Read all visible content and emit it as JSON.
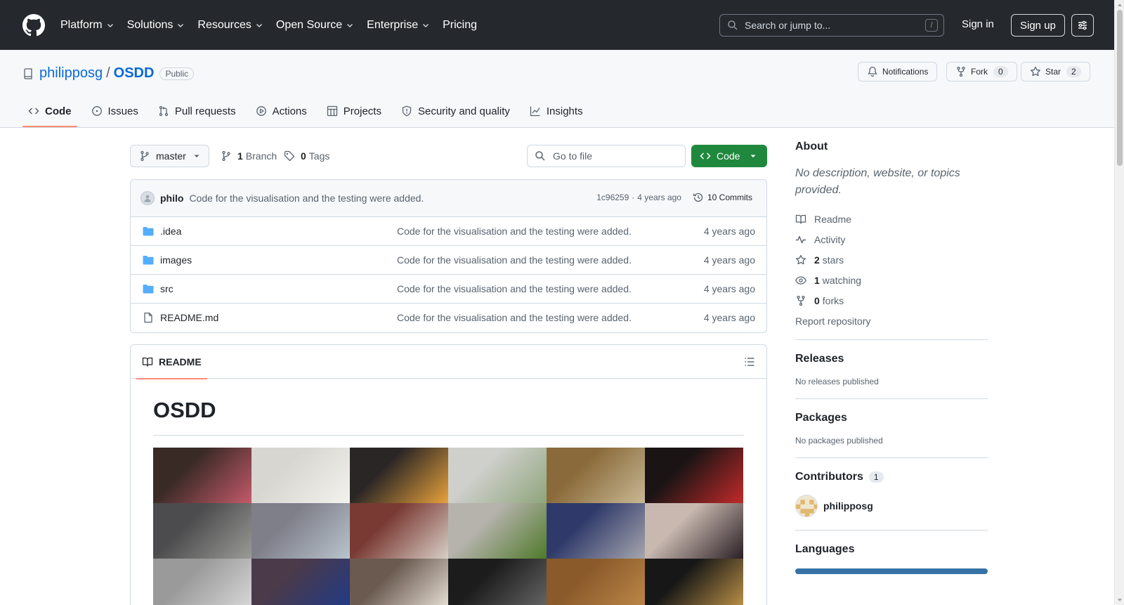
{
  "header": {
    "nav": [
      {
        "label": "Platform",
        "dropdown": true
      },
      {
        "label": "Solutions",
        "dropdown": true
      },
      {
        "label": "Resources",
        "dropdown": true
      },
      {
        "label": "Open Source",
        "dropdown": true
      },
      {
        "label": "Enterprise",
        "dropdown": true
      },
      {
        "label": "Pricing",
        "dropdown": false
      }
    ],
    "search_placeholder": "Search or jump to...",
    "search_shortcut": "/",
    "signin_label": "Sign in",
    "signup_label": "Sign up"
  },
  "repo": {
    "owner": "philipposg",
    "separator": "/",
    "name": "OSDD",
    "visibility": "Public",
    "notifications_label": "Notifications",
    "fork_label": "Fork",
    "fork_count": "0",
    "star_label": "Star",
    "star_count": "2"
  },
  "tabs": [
    {
      "label": "Code",
      "icon": "code-icon",
      "active": true
    },
    {
      "label": "Issues",
      "icon": "issue-icon",
      "active": false
    },
    {
      "label": "Pull requests",
      "icon": "pull-request-icon",
      "active": false
    },
    {
      "label": "Actions",
      "icon": "play-icon",
      "active": false
    },
    {
      "label": "Projects",
      "icon": "table-icon",
      "active": false
    },
    {
      "label": "Security and quality",
      "icon": "shield-icon",
      "active": false
    },
    {
      "label": "Insights",
      "icon": "graph-icon",
      "active": false
    }
  ],
  "toolbar": {
    "branch": "master",
    "branch_count": "1",
    "branch_label": "Branch",
    "tag_count": "0",
    "tag_label": "Tags",
    "goto_placeholder": "Go to file",
    "code_label": "Code"
  },
  "commit": {
    "author": "philo",
    "message": "Code for the visualisation and the testing were added.",
    "hash": "1c96259",
    "dot": "·",
    "age": "4 years ago",
    "commits_label": "10 Commits"
  },
  "files": [
    {
      "name": ".idea",
      "type": "folder",
      "message": "Code for the visualisation and the testing were added.",
      "age": "4 years ago"
    },
    {
      "name": "images",
      "type": "folder",
      "message": "Code for the visualisation and the testing were added.",
      "age": "4 years ago"
    },
    {
      "name": "src",
      "type": "folder",
      "message": "Code for the visualisation and the testing were added.",
      "age": "4 years ago"
    },
    {
      "name": "README.md",
      "type": "file",
      "message": "Code for the visualisation and the testing were added.",
      "age": "4 years ago"
    }
  ],
  "readme": {
    "tab_label": "README",
    "title": "OSDD",
    "tile_colors": [
      [
        "#3a2a26",
        "#c45a6a"
      ],
      [
        "#d8d6d0",
        "#f2f2ee"
      ],
      [
        "#2b2626",
        "#e8a23a"
      ],
      [
        "#cfd0cc",
        "#8fa57c"
      ],
      [
        "#8a6a3a",
        "#c8b894"
      ],
      [
        "#1a1414",
        "#c22a2a"
      ],
      [
        "#4c4c4e",
        "#9a9a96"
      ],
      [
        "#7f7f8a",
        "#b9c4cc"
      ],
      [
        "#7a3a34",
        "#d8cfc6"
      ],
      [
        "#b6b3ad",
        "#4f7a2a"
      ],
      [
        "#2f3a6a",
        "#a6a6ae"
      ],
      [
        "#c8b8b0",
        "#2a1f24"
      ],
      [
        "#9a9a9a",
        "#dcdcdc"
      ],
      [
        "#4a3a4a",
        "#1e3a8a"
      ],
      [
        "#6a5a50",
        "#efe8de"
      ],
      [
        "#1c1c1c",
        "#6a6a6a"
      ],
      [
        "#8a5a2a",
        "#c08a4a"
      ],
      [
        "#171717",
        "#c89a4a"
      ]
    ]
  },
  "about": {
    "heading": "About",
    "description": "No description, website, or topics provided.",
    "items": [
      {
        "icon": "book-icon",
        "label": "Readme",
        "count": ""
      },
      {
        "icon": "pulse-icon",
        "label": "Activity",
        "count": ""
      },
      {
        "icon": "star-icon",
        "label": "stars",
        "count": "2"
      },
      {
        "icon": "eye-icon",
        "label": "watching",
        "count": "1"
      },
      {
        "icon": "fork-icon",
        "label": "forks",
        "count": "0"
      }
    ],
    "report_label": "Report repository"
  },
  "releases": {
    "heading": "Releases",
    "text": "No releases published"
  },
  "packages": {
    "heading": "Packages",
    "text": "No packages published"
  },
  "contributors": {
    "heading": "Contributors",
    "count": "1",
    "name": "philipposg"
  },
  "languages": {
    "heading": "Languages",
    "bar_color": "#3572a5"
  }
}
